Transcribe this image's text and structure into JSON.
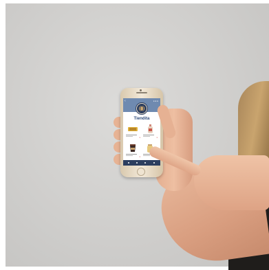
{
  "app": {
    "title": "Tiendita",
    "colors": {
      "header": "#6f8ab0",
      "title": "#2c4a7a",
      "nav": "#2c3e5f"
    },
    "header_icons": [
      "back-icon",
      "status-icon"
    ],
    "products": [
      {
        "icon": "snack-box-icon"
      },
      {
        "icon": "bottle-icon"
      },
      {
        "icon": "cup-icon"
      },
      {
        "icon": "jar-icon"
      }
    ],
    "nav_items": [
      "home-icon",
      "search-icon",
      "cart-icon",
      "profile-icon"
    ]
  }
}
